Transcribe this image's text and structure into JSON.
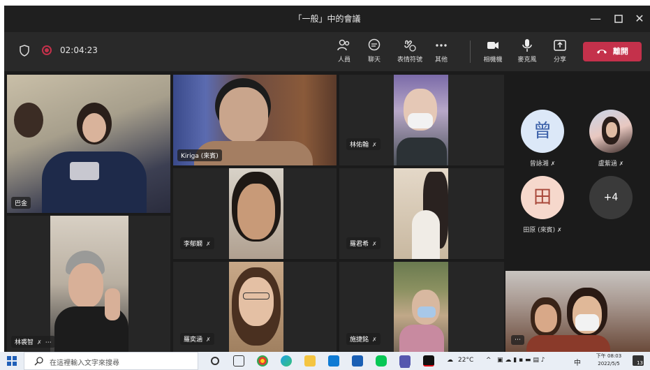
{
  "window": {
    "title": "「一般」中的會議"
  },
  "meeting": {
    "timer": "02:04:23"
  },
  "toolbar": {
    "people": "人員",
    "chat": "聊天",
    "reactions": "表情符號",
    "more": "其他",
    "camera": "相機機",
    "mic": "麥克風",
    "share": "分享",
    "leave": "離開"
  },
  "participants": {
    "tile_1": "巴金",
    "tile_2": "Kiriga (來賓)",
    "tile_3": "林佑翰",
    "tile_4": "李郁嫺",
    "tile_5": "羅君希",
    "tile_6": "林裘智",
    "tile_7": "羅奕涵",
    "tile_8": "施捷銘"
  },
  "side_participants": [
    {
      "initial": "曾",
      "name": "曾詠湘"
    },
    {
      "initial": "",
      "name": "盧紫涵"
    },
    {
      "initial": "田",
      "name": "田原 (來賓)"
    },
    {
      "initial": "+4",
      "name": ""
    }
  ],
  "icons": {
    "muted": "mic-off-icon",
    "more": "more-icon"
  },
  "taskbar": {
    "search_placeholder": "在這裡輸入文字來搜尋",
    "weather": "22°C",
    "ime": "中",
    "time": "下午 08:03",
    "date": "2022/5/5",
    "notifications": "13"
  },
  "colors": {
    "leave": "#c4314b",
    "accent": "#6264a7"
  }
}
